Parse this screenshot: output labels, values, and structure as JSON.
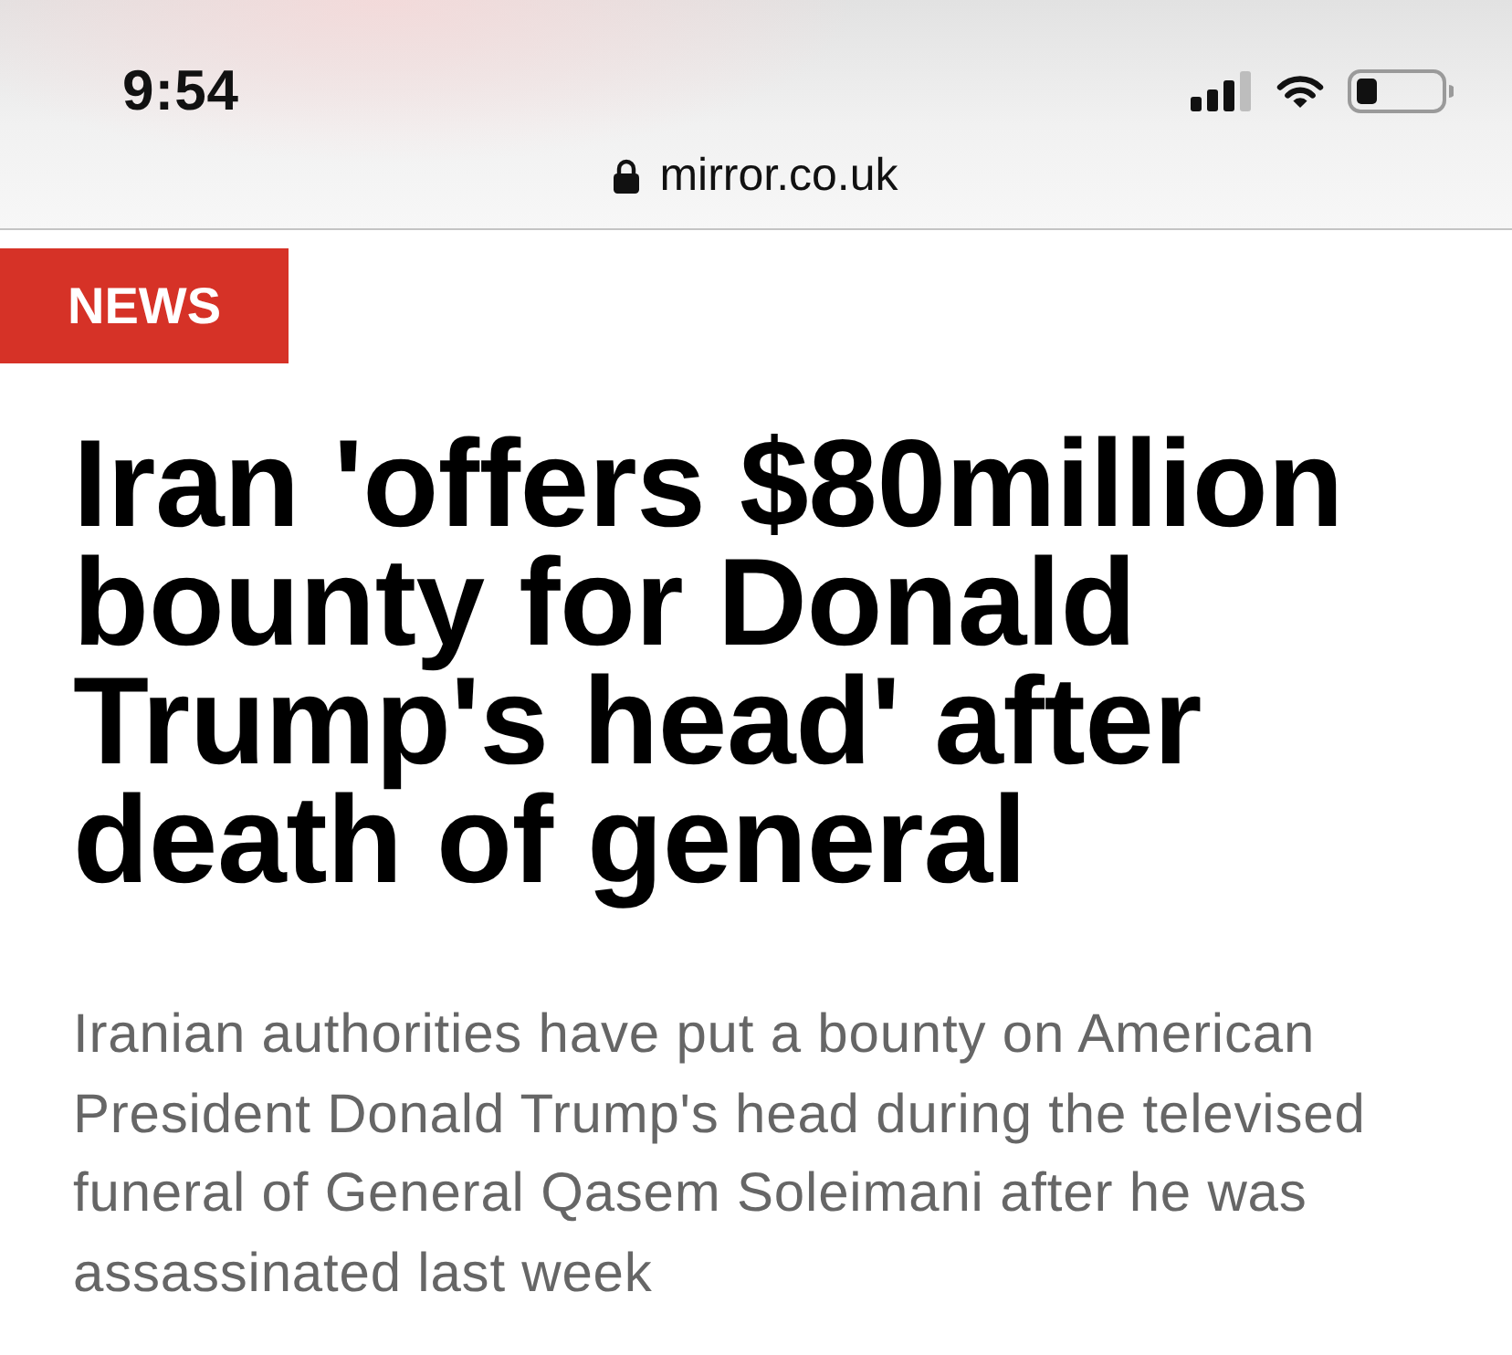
{
  "status_bar": {
    "time": "9:54"
  },
  "address_bar": {
    "url": "mirror.co.uk",
    "secure": true
  },
  "article": {
    "section": "NEWS",
    "headline": "Iran 'offers $80million bounty for Donald Trump's head' after death of general",
    "summary": "Iranian authorities have put a bounty on American President Donald Trump's head during the televised funeral of General Qasem Soleimani after he was assassinated last week"
  }
}
